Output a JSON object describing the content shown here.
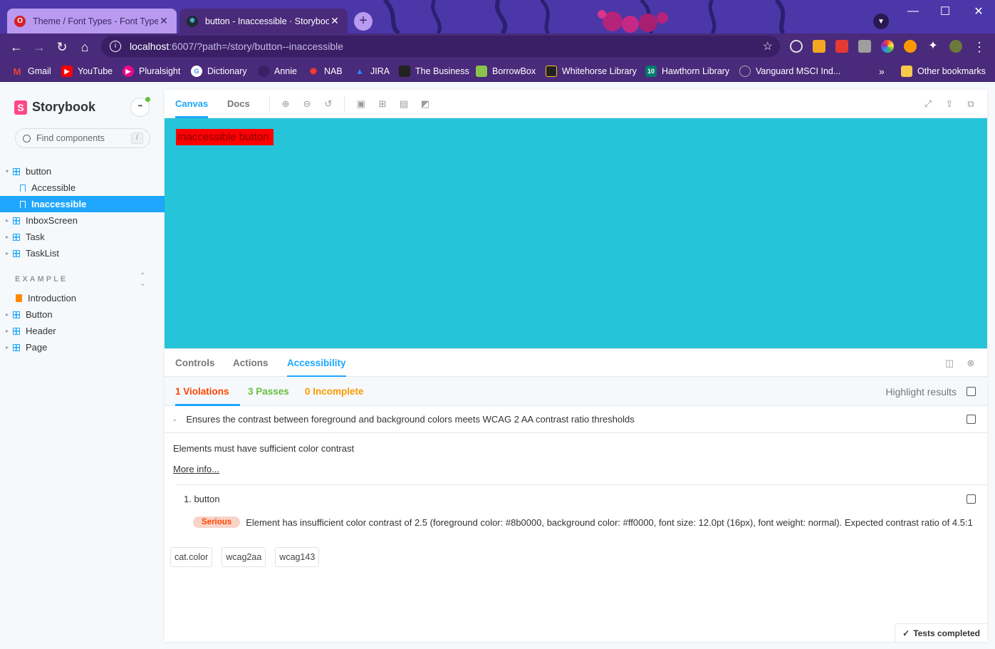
{
  "browser": {
    "tabs": [
      {
        "title": "Theme / Font Types - Font Types",
        "icon": "opera-icon"
      },
      {
        "title": "button - Inaccessible · Storybook",
        "icon": "storybook-react-icon"
      }
    ],
    "close_glyph": "✕",
    "new_tab_glyph": "+",
    "window_controls": {
      "minimize": "—",
      "maximize": "☐",
      "close": "✕"
    },
    "address": {
      "host": "localhost",
      "path": ":6007/?path=/story/button--inaccessible"
    },
    "bookmarks": [
      {
        "label": "Gmail",
        "color": "#ea4335",
        "glyph": "M"
      },
      {
        "label": "YouTube",
        "color": "#ff0000",
        "glyph": "▶"
      },
      {
        "label": "Pluralsight",
        "color": "#e80a89",
        "glyph": "▶"
      },
      {
        "label": "Dictionary",
        "color": "#ffffff",
        "glyph": "G"
      },
      {
        "label": "Annie",
        "color": "#3a1f66",
        "glyph": ""
      },
      {
        "label": "NAB",
        "color": "#c20000",
        "glyph": "✸"
      },
      {
        "label": "JIRA",
        "color": "#2684ff",
        "glyph": "▲"
      },
      {
        "label": "The Business",
        "color": "#222222",
        "glyph": "●"
      },
      {
        "label": "BorrowBox",
        "color": "#8bc34a",
        "glyph": "■"
      },
      {
        "label": "Whitehorse Library",
        "color": "#222222",
        "glyph": "■"
      },
      {
        "label": "Hawthorn Library",
        "color": "#00796b",
        "glyph": "10"
      },
      {
        "label": "Vanguard MSCI Ind...",
        "color": "#888888",
        "glyph": "●"
      }
    ],
    "overflow": "»",
    "other_bookmarks": "Other bookmarks"
  },
  "sidebar": {
    "brand": "Storybook",
    "brand_mark": "S",
    "menu_glyph": "•••",
    "search_placeholder": "Find components",
    "search_shortcut": "/",
    "tree": [
      {
        "label": "button",
        "kind": "component",
        "expanded": true
      },
      {
        "label": "Accessible",
        "kind": "story"
      },
      {
        "label": "Inaccessible",
        "kind": "story",
        "selected": true
      },
      {
        "label": "InboxScreen",
        "kind": "component"
      },
      {
        "label": "Task",
        "kind": "component"
      },
      {
        "label": "TaskList",
        "kind": "component"
      }
    ],
    "section_title": "EXAMPLE",
    "example_tree": [
      {
        "label": "Introduction",
        "kind": "docs"
      },
      {
        "label": "Button",
        "kind": "component"
      },
      {
        "label": "Header",
        "kind": "component"
      },
      {
        "label": "Page",
        "kind": "component"
      }
    ]
  },
  "toolbar": {
    "tabs": [
      "Canvas",
      "Docs"
    ],
    "active_tab": "Canvas"
  },
  "canvas": {
    "background": "#26c4d8",
    "button_label": "Inaccessible button",
    "button_bg": "#ff0000",
    "button_fg": "#8b0000"
  },
  "addons": {
    "tabs": [
      "Controls",
      "Actions",
      "Accessibility"
    ],
    "active_tab": "Accessibility"
  },
  "a11y": {
    "violations": "1 Violations",
    "passes": "3 Passes",
    "incomplete": "0 Incomplete",
    "highlight_label": "Highlight results",
    "rule": "Ensures the contrast between foreground and background colors meets WCAG 2 AA contrast ratio thresholds",
    "rule_description": "Elements must have sufficient color contrast",
    "more_info": "More info...",
    "node": "1. button",
    "impact": "Serious",
    "message": "Element has insufficient color contrast of 2.5 (foreground color: #8b0000, background color: #ff0000, font size: 12.0pt (16px), font weight: normal). Expected contrast ratio of 4.5:1",
    "tags": [
      "cat.color",
      "wcag2aa",
      "wcag143"
    ],
    "status": "Tests completed"
  }
}
